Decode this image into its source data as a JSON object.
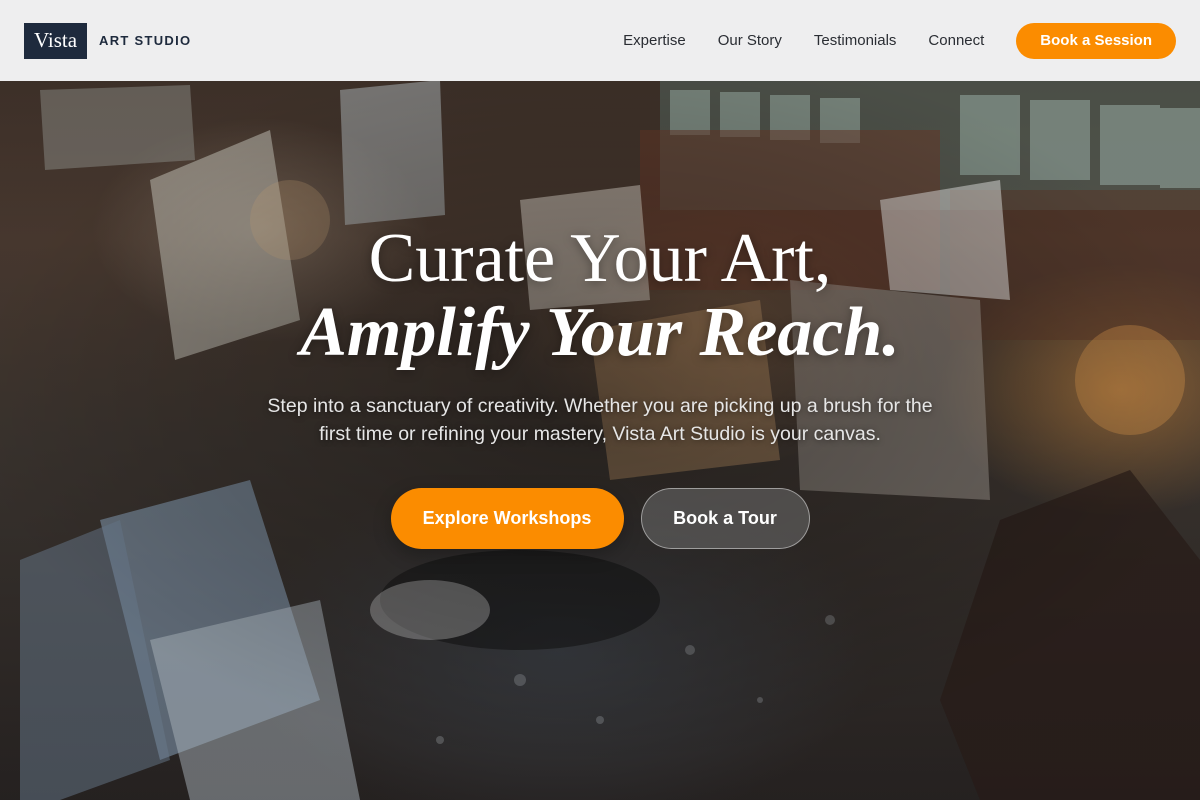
{
  "brand": {
    "logo_mark": "Vista",
    "logo_text": "ART STUDIO"
  },
  "nav": {
    "items": [
      {
        "label": "Expertise"
      },
      {
        "label": "Our Story"
      },
      {
        "label": "Testimonials"
      },
      {
        "label": "Connect"
      }
    ],
    "cta_label": "Book a Session"
  },
  "hero": {
    "title_line1": "Curate Your Art,",
    "title_line2": "Amplify Your Reach.",
    "subtitle": "Step into a sanctuary of creativity. Whether you are picking up a brush for the first time or refining your mastery, Vista Art Studio is your canvas.",
    "primary_button": "Explore Workshops",
    "secondary_button": "Book a Tour",
    "background_image": "art-studio-interior-photo"
  },
  "colors": {
    "accent": "#fb8c00",
    "brand_navy": "#1e2a3d",
    "header_bg": "#eeeeef"
  }
}
